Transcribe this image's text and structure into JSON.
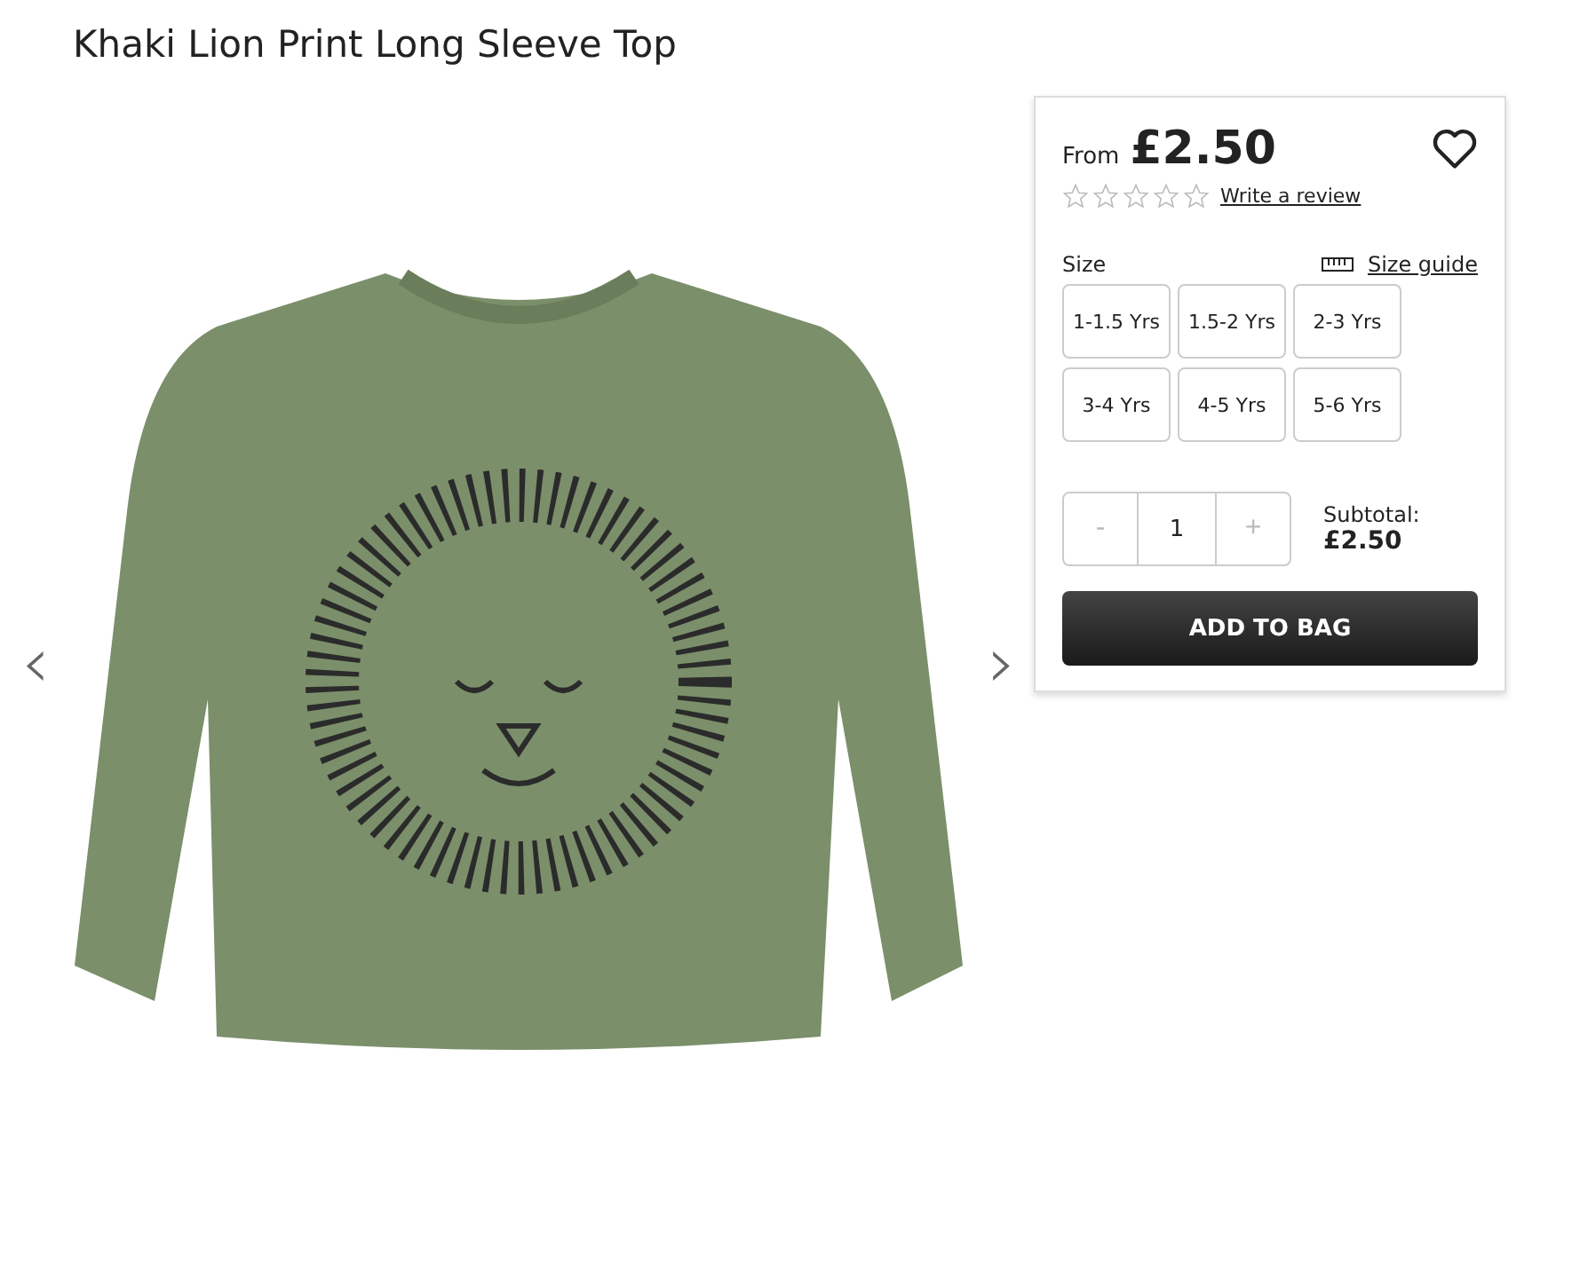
{
  "title": "Khaki Lion Print Long Sleeve Top",
  "gallery": {
    "prev": "‹",
    "next": "›"
  },
  "panel": {
    "from_label": "From",
    "price": "£2.50",
    "favourite": false,
    "rating": {
      "stars": 0,
      "link": "Write a review"
    },
    "size_label": "Size",
    "size_guide": "Size guide",
    "sizes": [
      {
        "label": "1-1.5 Yrs",
        "selected": false
      },
      {
        "label": "1.5-2 Yrs",
        "selected": false
      },
      {
        "label": "2-3 Yrs",
        "selected": false
      },
      {
        "label": "3-4 Yrs",
        "selected": false
      },
      {
        "label": "4-5 Yrs",
        "selected": false
      },
      {
        "label": "5-6 Yrs",
        "selected": false
      }
    ],
    "quantity": {
      "minus": "-",
      "value": "1",
      "plus": "+"
    },
    "subtotal_label": "Subtotal:",
    "subtotal": "£2.50",
    "add_button": "ADD TO BAG"
  }
}
